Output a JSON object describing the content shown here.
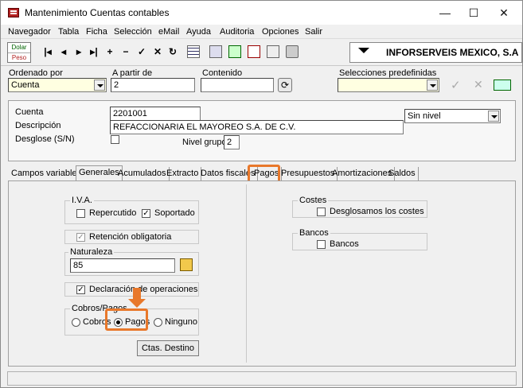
{
  "window": {
    "title": "Mantenimiento Cuentas contables",
    "minimize": "—",
    "maximize": "☐",
    "close": "✕"
  },
  "menu": [
    "Navegador",
    "Tabla",
    "Ficha",
    "Selección",
    "eMail",
    "Ayuda",
    "Auditoria",
    "Opciones",
    "Salir"
  ],
  "toolbar": {
    "currency_top": "Dolar",
    "currency_bottom": "Peso",
    "nav_icons": [
      "first-icon",
      "prev-icon",
      "next-icon",
      "last-icon",
      "add-icon",
      "delete-icon",
      "confirm-icon",
      "cancel-icon",
      "refresh-icon"
    ],
    "company": "INFORSERVEIS MEXICO, S.A"
  },
  "filters": {
    "ordenado_label": "Ordenado por",
    "ordenado_value": "Cuenta",
    "partir_label": "A partir de",
    "partir_value": "2",
    "contenido_label": "Contenido",
    "contenido_value": "",
    "selecciones_label": "Selecciones predefinidas",
    "selecciones_value": ""
  },
  "record": {
    "cuenta_label": "Cuenta",
    "cuenta_value": "2201001",
    "nivel_value": "Sin nivel",
    "descripcion_label": "Descripción",
    "descripcion_value": "REFACCIONARIA  EL  MAYOREO S.A. DE C.V.",
    "desglose_label": "Desglose (S/N)",
    "nivel_grupo_label": "Nivel grupo",
    "nivel_grupo_value": "2"
  },
  "tabs": [
    "Campos variables",
    "Generales",
    "Acumulados",
    "Extracto",
    "Datos fiscales",
    "Pagos",
    "Presupuestos",
    "Amortizaciones",
    "Saldos"
  ],
  "generales": {
    "iva_title": "I.V.A.",
    "repercutido": "Repercutido",
    "soportado": "Soportado",
    "retencion": "Retención obligatoria",
    "naturaleza_title": "Naturaleza",
    "naturaleza_value": "85",
    "declaracion": "Declaración de operaciones",
    "cobros_title": "Cobros/Pagos",
    "cobros": "Cobros",
    "pagos": "Pagos",
    "ninguno": "Ninguno",
    "ctas_destino": "Ctas. Destino",
    "costes_title": "Costes",
    "desglosamos": "Desglosamos los costes",
    "bancos_title": "Bancos",
    "bancos": "Bancos"
  },
  "colors": {
    "highlight": "#e8782b",
    "field_yellow": "#ffffe1"
  }
}
